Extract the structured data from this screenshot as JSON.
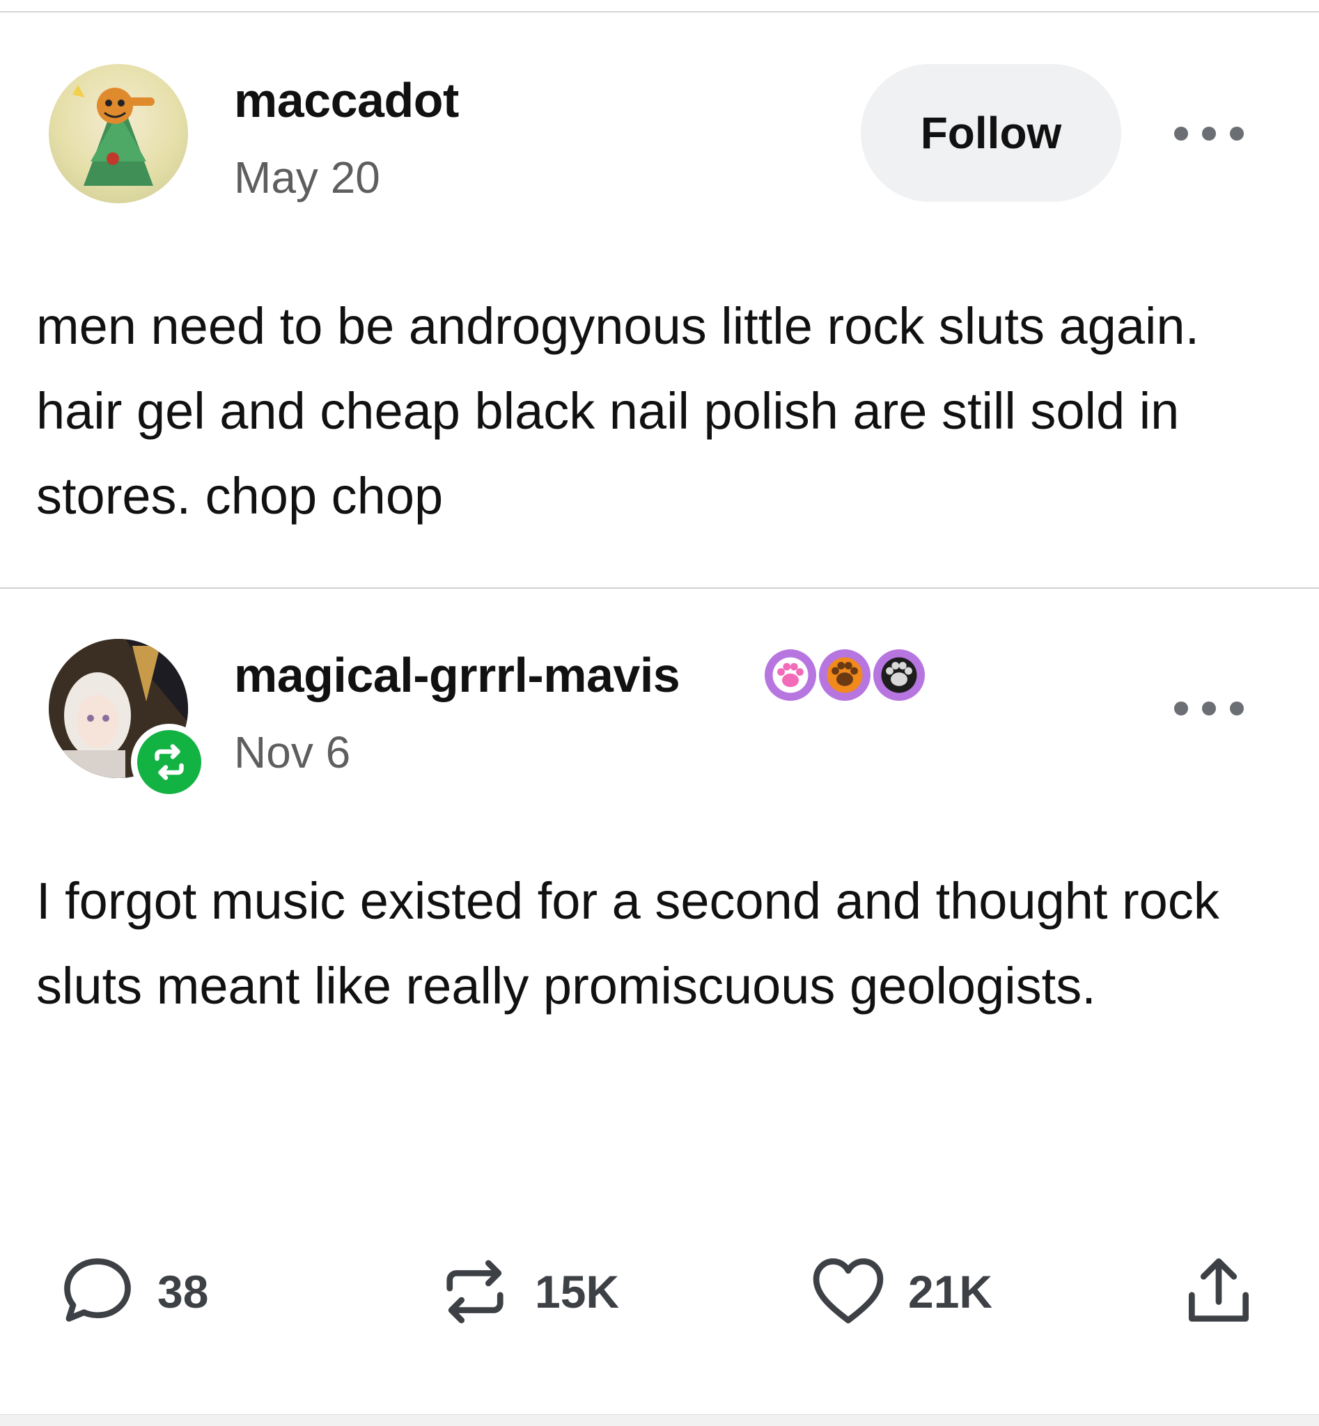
{
  "posts": [
    {
      "username": "maccadot",
      "date": "May 20",
      "follow_label": "Follow",
      "avatar_icon": "garfield-christmas-tree-avatar",
      "text": "men need to be androgynous little rock sluts again. hair gel and cheap black nail polish are still sold in stores. chop chop"
    },
    {
      "username": "magical-grrrl-mavis",
      "date": "Nov 6",
      "avatar_icon": "anime-character-avatar",
      "reblog_badge_icon": "reblog-icon",
      "badges": [
        "pink-paw-badge",
        "orange-paw-badge",
        "black-paw-badge"
      ],
      "text": "I forgot music existed for a second and thought rock sluts meant like really promiscuous geologists."
    }
  ],
  "actions": {
    "comments": "38",
    "reblogs": "15K",
    "likes": "21K"
  },
  "colors": {
    "reblog_green": "#12b243",
    "follow_bg": "#f0f1f3",
    "date_gray": "#5e5e5e",
    "icon_gray": "#3d4045"
  }
}
